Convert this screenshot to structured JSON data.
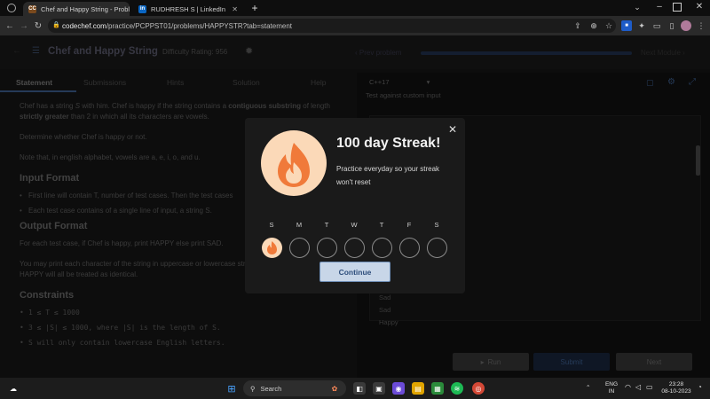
{
  "browser": {
    "tabs": [
      {
        "label": "Chef and Happy String - Proble",
        "favicon_text": "CC",
        "active": true
      },
      {
        "label": "RUDHRESH S | LinkedIn",
        "favicon_text": "in",
        "active": false
      }
    ],
    "url_host": "codechef.com",
    "url_path": "/practice/PCPPST01/problems/HAPPYSTR?tab=statement"
  },
  "problem": {
    "title": "Chef and Happy String",
    "difficulty_label": "Difficulty Rating:",
    "difficulty_value": "956",
    "prev_label": "Prev problem",
    "next_label": "Next Module",
    "tabs": [
      "Statement",
      "Submissions",
      "Hints",
      "Solution",
      "Help"
    ],
    "statement": {
      "p1_a": "Chef has a string ",
      "p1_var": "S",
      "p1_b": " with him. Chef is happy if the string contains a ",
      "p1_bold1": "contiguous substring",
      "p1_c": " of length ",
      "p1_bold2": "strictly greater",
      "p1_d": " than 2 in which all its characters are vowels.",
      "p2": "Determine whether Chef is happy or not.",
      "p3": "Note that, in english alphabet, vowels are a, e, i, o, and u.",
      "input_heading": "Input Format",
      "input_items": [
        "First line will contain T, number of test cases. Then the test cases",
        "Each test case contains of a single line of input, a string S."
      ],
      "output_heading": "Output Format",
      "output_p1": "For each test case, if Chef is happy, print HAPPY else print SAD.",
      "output_p2": "You may print each character of the string in uppercase or lowercase strings hAppY, Happy, haPpY, and HAPPY will all be treated as identical.",
      "constraints_heading": "Constraints",
      "constraints": [
        "1 ≤ T ≤ 1000",
        "3 ≤ |S| ≤ 1000, where |S| is the length of S.",
        "S will only contain lowercase English letters."
      ]
    }
  },
  "editor": {
    "language": "C++17",
    "custom_input_label": "Test against custom input",
    "outputs": [
      "Sad",
      "Sad",
      "Happy"
    ],
    "run_label": "Run",
    "submit_label": "Submit",
    "next_label": "Next"
  },
  "modal": {
    "title": "100 day Streak!",
    "message": "Practice everyday so your streak won't reset",
    "days": [
      "S",
      "M",
      "T",
      "W",
      "T",
      "F",
      "S"
    ],
    "completed_days": 1,
    "continue_label": "Continue",
    "accent": "#fbd9b8"
  },
  "taskbar": {
    "search_label": "Search",
    "lang_line1": "ENG",
    "lang_line2": "IN",
    "time": "23:28",
    "date": "08-10-2023"
  }
}
